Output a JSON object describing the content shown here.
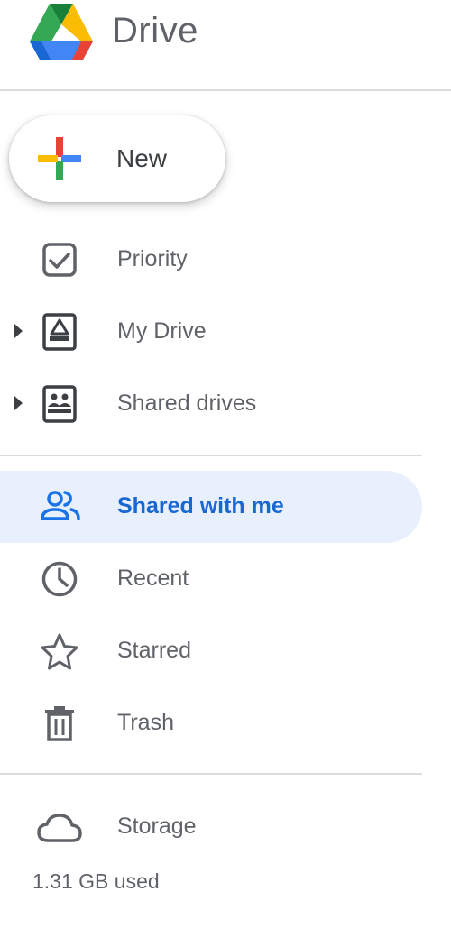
{
  "header": {
    "app_title": "Drive"
  },
  "new_button": {
    "label": "New"
  },
  "nav_primary": [
    {
      "label": "Priority",
      "icon": "priority-checkbox-icon"
    },
    {
      "label": "My Drive",
      "icon": "my-drive-icon",
      "expandable": true
    },
    {
      "label": "Shared drives",
      "icon": "shared-drives-icon",
      "expandable": true
    }
  ],
  "nav_secondary": [
    {
      "label": "Shared with me",
      "icon": "people-icon",
      "active": true
    },
    {
      "label": "Recent",
      "icon": "clock-icon"
    },
    {
      "label": "Starred",
      "icon": "star-icon"
    },
    {
      "label": "Trash",
      "icon": "trash-icon"
    }
  ],
  "storage": {
    "label": "Storage",
    "icon": "cloud-icon",
    "used": "1.31 GB used"
  },
  "colors": {
    "active_bg": "#e8f0fe",
    "active_text": "#1967d2",
    "text": "#5f6368",
    "divider": "#dadce0",
    "google_blue": "#4285f4",
    "google_red": "#ea4335",
    "google_yellow": "#fbbc04",
    "google_green": "#34a853"
  }
}
